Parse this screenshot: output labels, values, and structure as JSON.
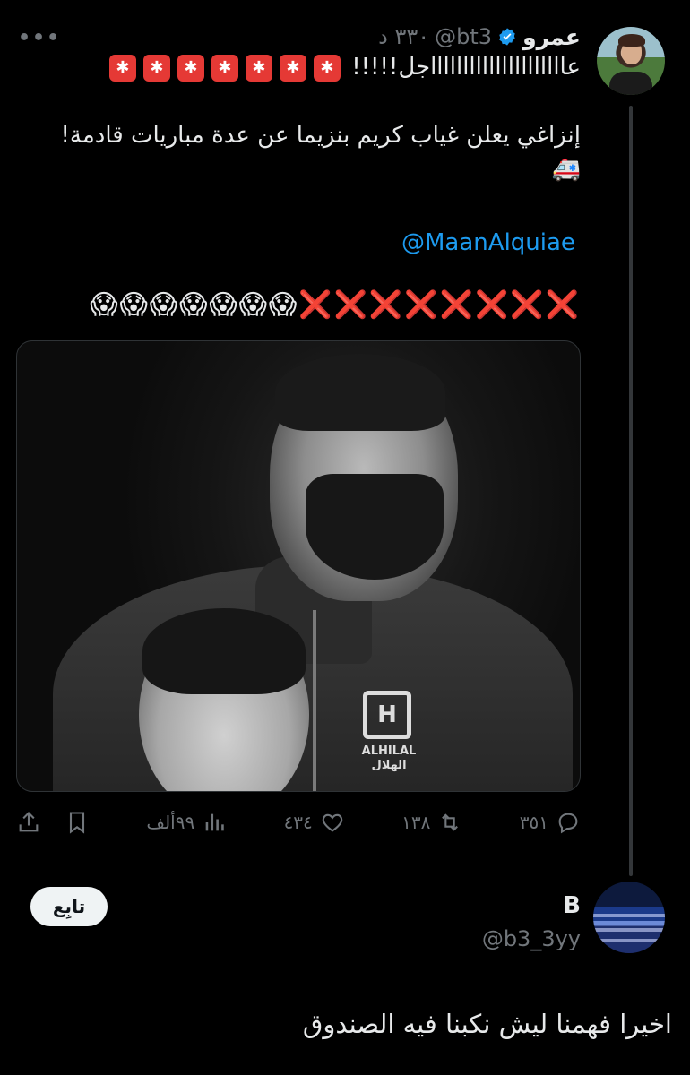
{
  "tweet": {
    "display_name": "عمرو",
    "handle": "@bt3",
    "timestamp": "٣٣٠ د",
    "line1_text": "عاااااااااااااااااااااجل!!!!!",
    "line2_text": "إنزاغي يعلن غياب كريم بنزيما عن عدة مباريات قادمة!",
    "mention": "@MaanAlquiae",
    "crosses": "❌❌❌❌❌❌❌❌",
    "scream_emojis": "😱😱😱😱😱😱😱",
    "ambulance": "🚑",
    "media": {
      "logo_letter": "H",
      "logo_text_en": "ALHILAL",
      "logo_text_ar": "الهلال"
    },
    "stats": {
      "replies": "٣٥١",
      "retweets": "١٣٨",
      "likes": "٤٣٤",
      "views": "٩٩ألف"
    },
    "icons": {
      "verified": "verified-badge-icon",
      "more": "more-icon",
      "reply": "reply-icon",
      "retweet": "retweet-icon",
      "like": "heart-icon",
      "views": "views-icon",
      "bookmark": "bookmark-icon",
      "share": "share-icon"
    },
    "colors": {
      "accent": "#1d9bf0",
      "background": "#000000",
      "muted": "#71767b"
    }
  },
  "reply_author": {
    "display_name": "B",
    "handle": "@b3_3yy",
    "follow_label": "تابِع",
    "text": "اخيرا فهمنا ليش نكبنا فيه الصندوق"
  }
}
